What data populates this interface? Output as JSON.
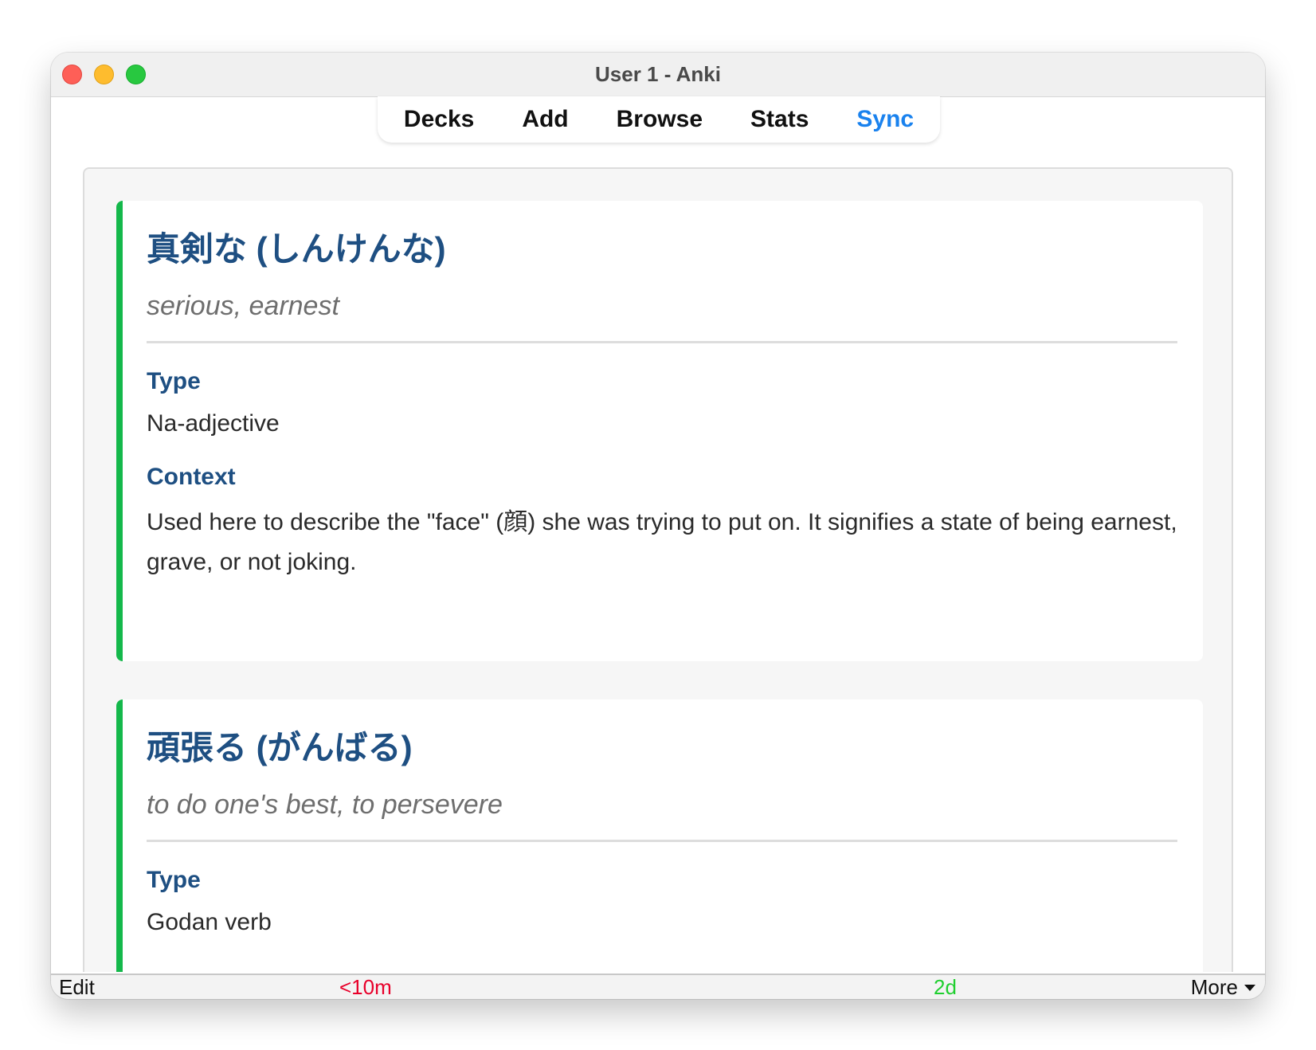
{
  "window": {
    "title": "User 1 - Anki"
  },
  "nav": {
    "decks": "Decks",
    "add": "Add",
    "browse": "Browse",
    "stats": "Stats",
    "sync": "Sync"
  },
  "cards": [
    {
      "word": "真剣な (しんけんな)",
      "meaning": "serious, earnest",
      "type_label": "Type",
      "type_value": "Na-adjective",
      "context_label": "Context",
      "context_value": "Used here to describe the \"face\" (顔) she was trying to put on. It signifies a state of being earnest, grave, or not joking."
    },
    {
      "word": "頑張る (がんばる)",
      "meaning": "to do one's best, to persevere",
      "type_label": "Type",
      "type_value": "Godan verb"
    }
  ],
  "bottombar": {
    "edit": "Edit",
    "again_interval": "<10m",
    "good_interval": "2d",
    "more": "More"
  },
  "colors": {
    "accent_border": "#14b84b",
    "heading": "#1e4f82",
    "sync": "#1a82ee",
    "again": "#e8002a",
    "good": "#1fcf2f"
  },
  "icons": {
    "more_caret": "chevron-down-icon"
  }
}
